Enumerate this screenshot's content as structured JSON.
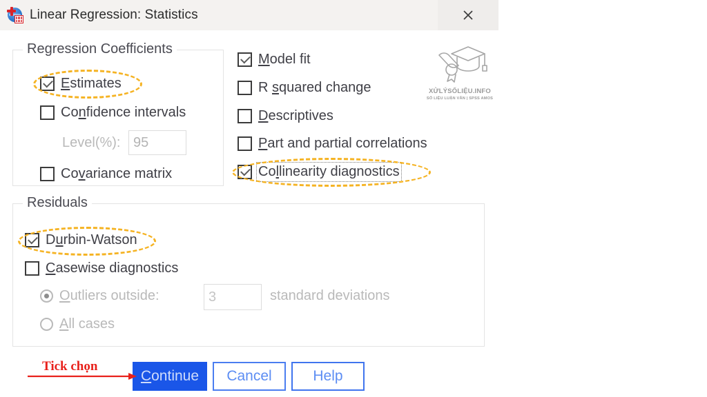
{
  "window": {
    "title": "Linear Regression: Statistics",
    "app_icon": "spss-statistics-icon",
    "close_icon": "close-icon"
  },
  "regression_coefficients": {
    "group_title": "Regression Coefficients",
    "items": [
      {
        "label": "Estimates",
        "mnemonic": "E",
        "checked": true,
        "highlighted": true
      },
      {
        "label": "Confidence intervals",
        "mnemonic": "n",
        "checked": false,
        "highlighted": false
      },
      {
        "label": "Covariance matrix",
        "mnemonic": "v",
        "checked": false,
        "highlighted": false
      }
    ],
    "level_label": "Level(%):",
    "level_value": "95"
  },
  "statistics_options": {
    "items": [
      {
        "label": "Model fit",
        "mnemonic": "M",
        "checked": true,
        "highlighted": false,
        "focused": false
      },
      {
        "label": "R squared change",
        "mnemonic": "s",
        "checked": false,
        "highlighted": false,
        "focused": false
      },
      {
        "label": "Descriptives",
        "mnemonic": "D",
        "checked": false,
        "highlighted": false,
        "focused": false
      },
      {
        "label": "Part and partial correlations",
        "mnemonic": "P",
        "checked": false,
        "highlighted": false,
        "focused": false
      },
      {
        "label": "Collinearity diagnostics",
        "mnemonic": "l",
        "checked": true,
        "highlighted": true,
        "focused": true
      }
    ]
  },
  "residuals": {
    "group_title": "Residuals",
    "durbin_watson": {
      "label": "Durbin-Watson",
      "mnemonic": "u",
      "checked": true,
      "highlighted": true
    },
    "casewise": {
      "label": "Casewise diagnostics",
      "mnemonic": "C",
      "checked": false,
      "highlighted": false
    },
    "outliers_outside": {
      "label": "Outliers outside:",
      "mnemonic": "O",
      "selected": true,
      "disabled": true
    },
    "outliers_value": "3",
    "standard_deviations_label": "standard deviations",
    "all_cases": {
      "label": "All cases",
      "mnemonic": "A",
      "selected": false,
      "disabled": true
    }
  },
  "buttons": {
    "continue": "Continue",
    "continue_mnemonic": "C",
    "cancel": "Cancel",
    "help": "Help"
  },
  "annotation": {
    "text": "Tick chọn",
    "color": "#e8211b",
    "arrow_icon": "red-arrow-right-icon"
  },
  "watermark": {
    "logo_icon": "graduation-cap-diploma-icon",
    "title": "XỬLÝSỐLIỆU.INFO",
    "subtitle": "SỐ LIỆU LUẬN VĂN | SPSS AMOS"
  },
  "colors": {
    "highlight": "#f5b323",
    "primary_button": "#1a56e8",
    "secondary_button_border": "#4a7df0",
    "annotation_red": "#e8211b",
    "titlebar_bg": "#f4f2f0"
  }
}
